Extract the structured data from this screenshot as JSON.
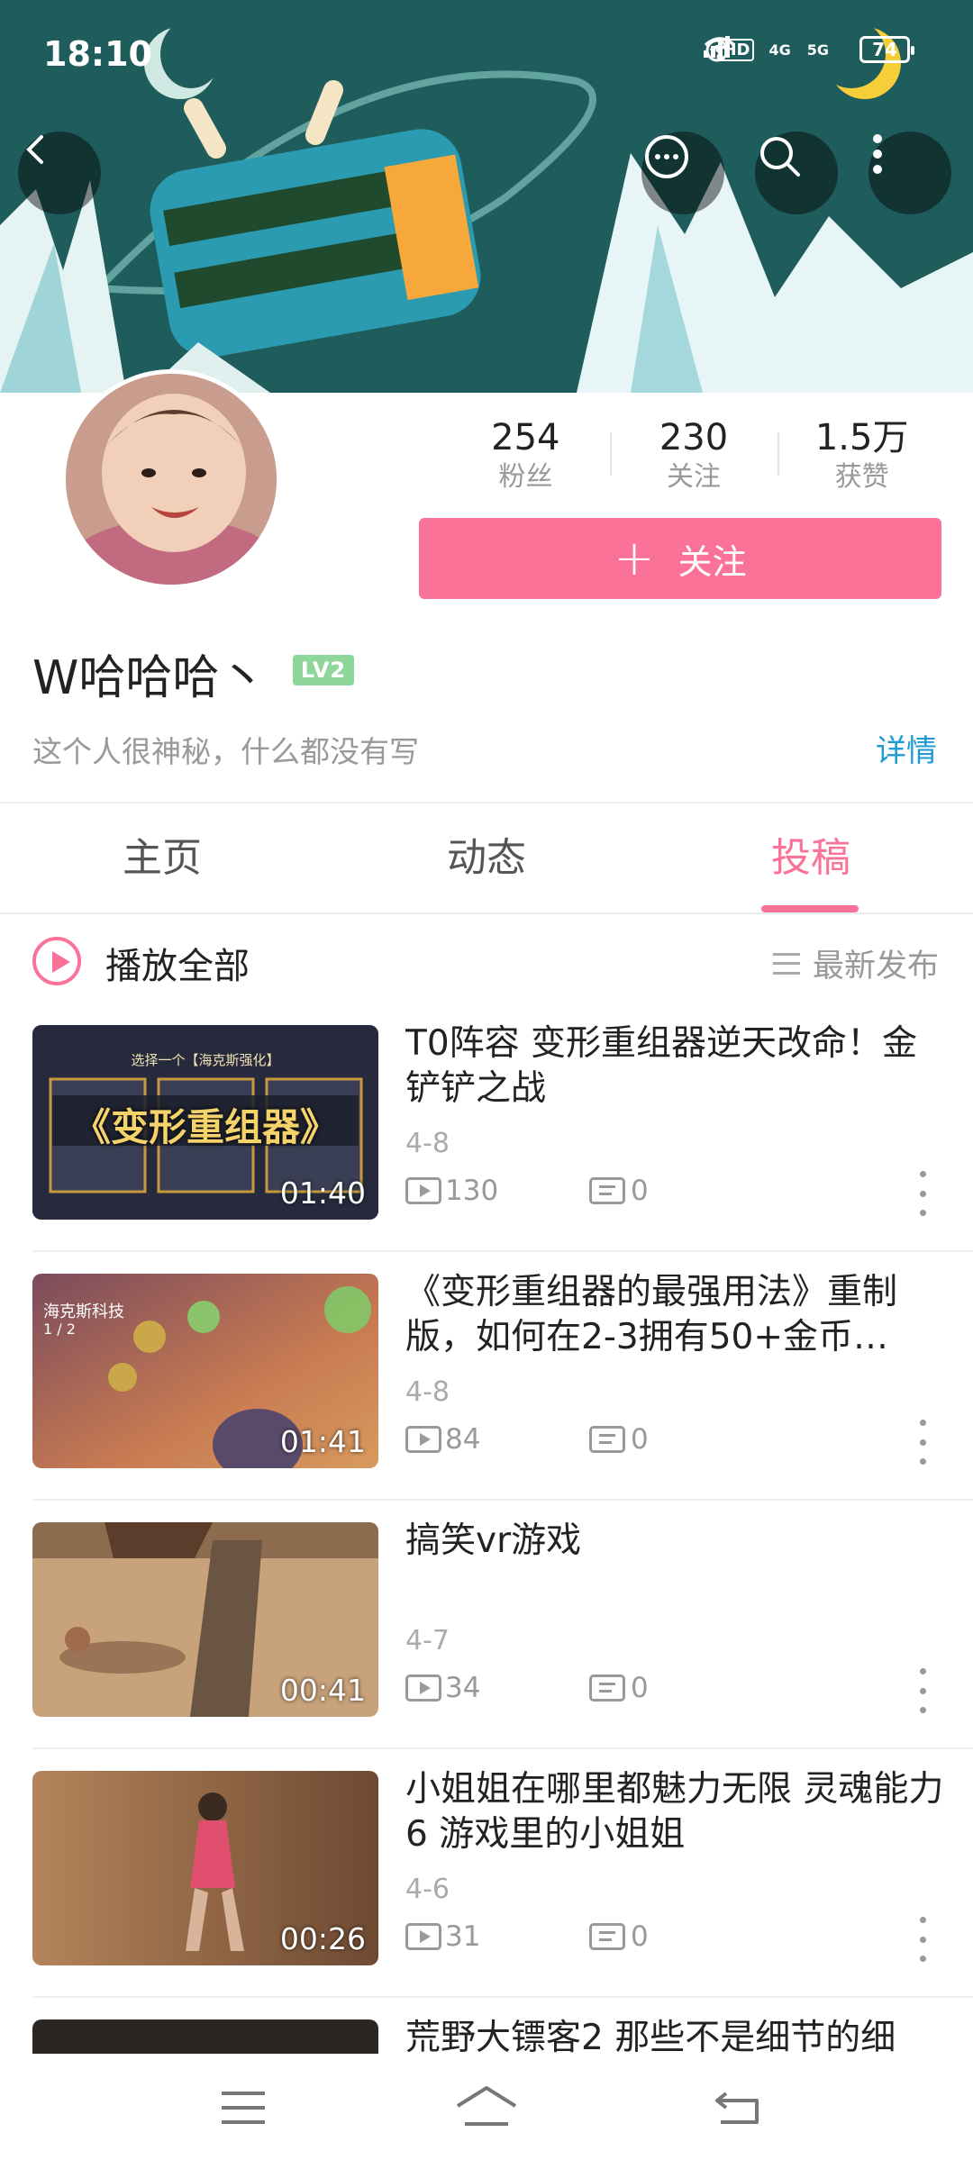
{
  "status_bar": {
    "time": "18:10",
    "network_a": "4G",
    "network_b": "5G",
    "hd_label": "HD",
    "battery": "74"
  },
  "profile": {
    "stats": [
      {
        "value": "254",
        "label": "粉丝"
      },
      {
        "value": "230",
        "label": "关注"
      },
      {
        "value": "1.5万",
        "label": "获赞"
      }
    ],
    "follow_label": "关注",
    "username": "W哈哈哈丶",
    "level_badge": "LV2",
    "bio": "这个人很神秘，什么都没有写",
    "detail_label": "详情"
  },
  "tabs": [
    {
      "label": "主页",
      "active": false
    },
    {
      "label": "动态",
      "active": false
    },
    {
      "label": "投稿",
      "active": true
    }
  ],
  "play_all": {
    "label": "播放全部",
    "sort_label": "最新发布"
  },
  "videos": [
    {
      "title": "T0阵容 变形重组器逆天改命！金铲铲之战",
      "date": "4-8",
      "plays": "130",
      "comments": "0",
      "duration": "01:40",
      "thumb_caption": "《变形重组器》",
      "thumb_subcaption": "选择一个【海克斯强化】"
    },
    {
      "title": "《变形重组器的最强用法》重制版，如何在2-3拥有50+金币…",
      "date": "4-8",
      "plays": "84",
      "comments": "0",
      "duration": "01:41",
      "thumb_caption": "海克斯科技",
      "thumb_subcaption": "1 / 2"
    },
    {
      "title": "搞笑vr游戏",
      "date": "4-7",
      "plays": "34",
      "comments": "0",
      "duration": "00:41"
    },
    {
      "title": "小姐姐在哪里都魅力无限 灵魂能力6  游戏里的小姐姐",
      "date": "4-6",
      "plays": "31",
      "comments": "0",
      "duration": "00:26"
    },
    {
      "title": "荒野大镖客2 那些不是细节的细"
    }
  ],
  "colors": {
    "accent": "#fb7299",
    "link": "#1e9bd7",
    "banner": "#1d5b5a"
  }
}
